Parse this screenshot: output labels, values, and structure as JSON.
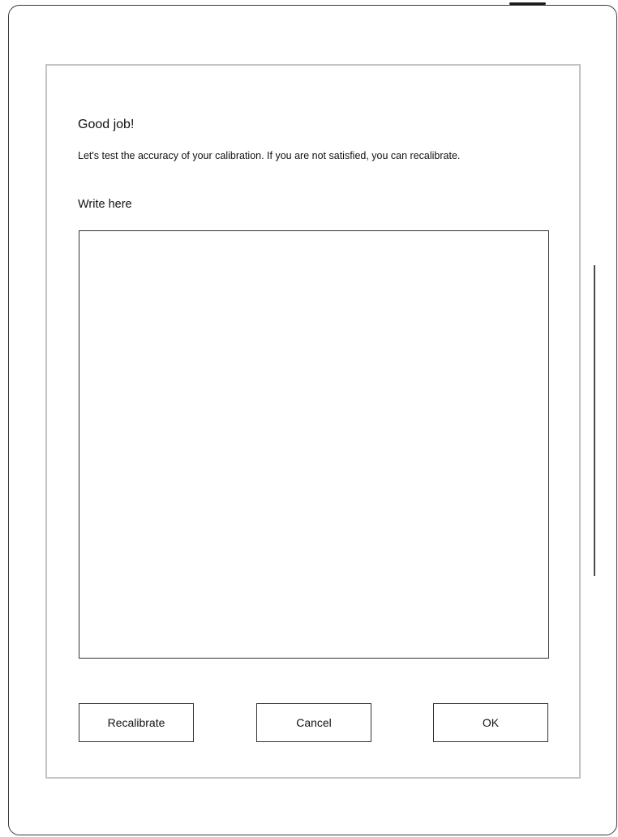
{
  "dialog": {
    "title": "Good job!",
    "message": "Let's test the accuracy of your calibration. If you are not satisfied, you can recalibrate.",
    "write_label": "Write here"
  },
  "buttons": {
    "recalibrate": "Recalibrate",
    "cancel": "Cancel",
    "ok": "OK"
  }
}
